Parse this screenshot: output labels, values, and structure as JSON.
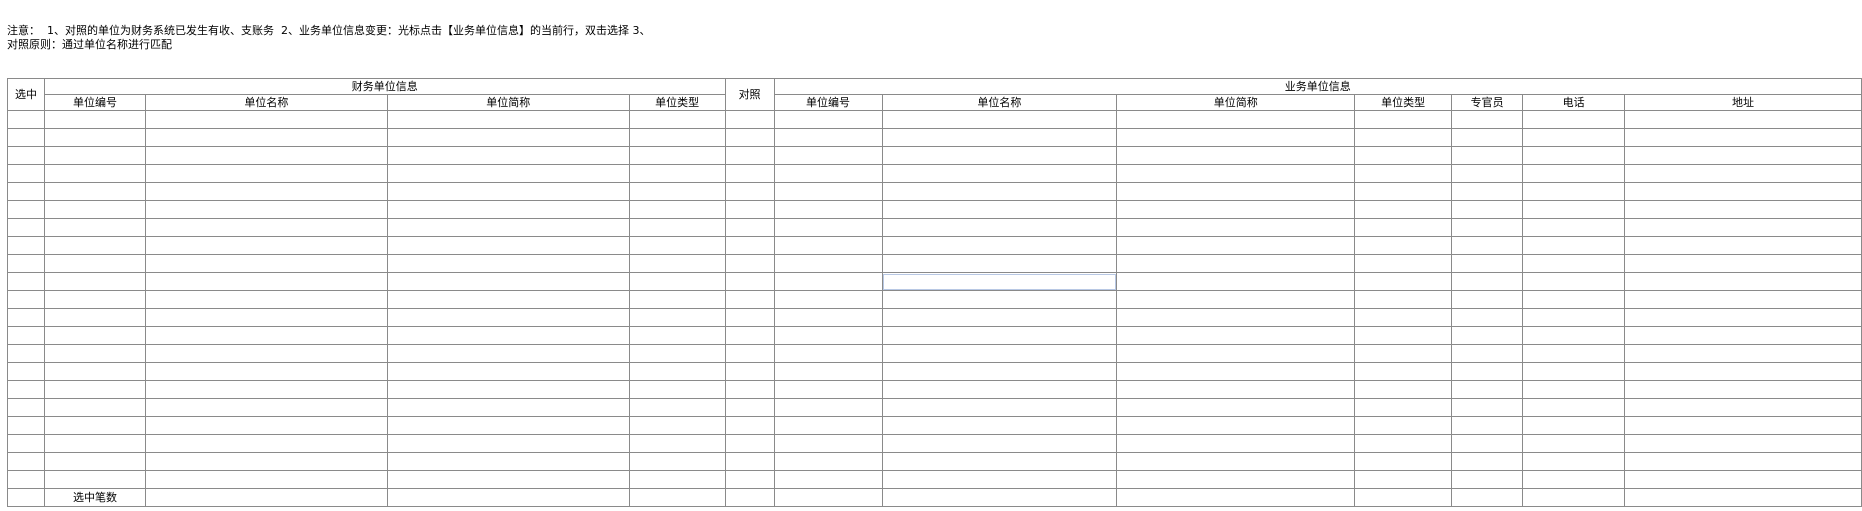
{
  "notes": {
    "line1": "注意：  1、对照的单位为财务系统已发生有收、支账务  2、业务单位信息变更：光标点击【业务单位信息】的当前行，双击选择 3、",
    "line2": "对照原则：通过单位名称进行匹配"
  },
  "table": {
    "select_header": "选中",
    "finance_group": "财务单位信息",
    "map_header": "对照",
    "business_group": "业务单位信息",
    "finance_columns": [
      "单位编号",
      "单位名称",
      "单位简称",
      "单位类型"
    ],
    "business_columns": [
      "单位编号",
      "单位名称",
      "单位简称",
      "单位类型",
      "专官员",
      "电话",
      "地址"
    ],
    "footer_label": "选中笔数"
  }
}
